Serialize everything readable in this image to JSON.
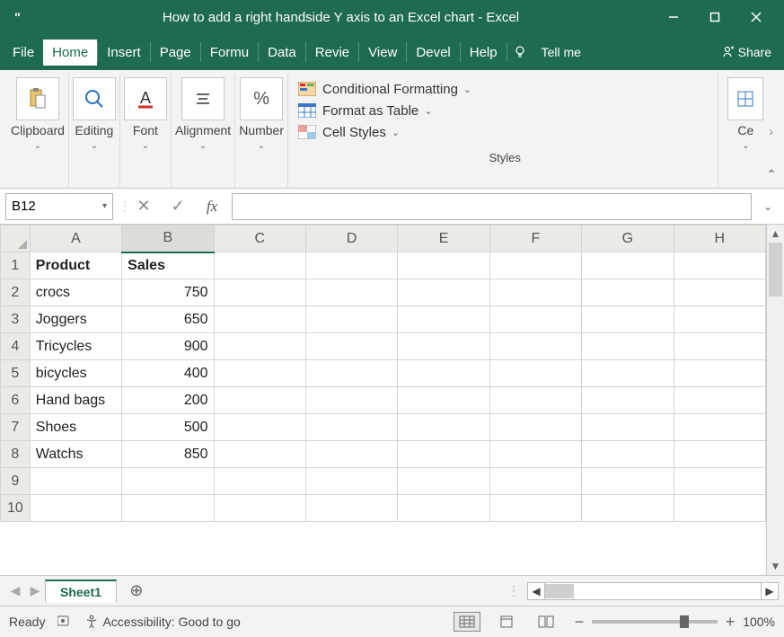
{
  "titlebar": {
    "title": "How to add a right handside Y axis to an Excel chart  -  Excel"
  },
  "tabs": {
    "file": "File",
    "home": "Home",
    "insert": "Insert",
    "page": "Page",
    "formulas": "Formu",
    "data": "Data",
    "review": "Revie",
    "view": "View",
    "developer": "Devel",
    "help": "Help",
    "tellme": "Tell me",
    "share": "Share"
  },
  "ribbon": {
    "clipboard": "Clipboard",
    "editing": "Editing",
    "font": "Font",
    "alignment": "Alignment",
    "number": "Number",
    "conditional": "Conditional Formatting",
    "formatastable": "Format as Table",
    "cellstyles": "Cell Styles",
    "styles": "Styles",
    "cells": "Ce"
  },
  "namebox": {
    "ref": "B12"
  },
  "formula": {
    "fx": "fx",
    "value": ""
  },
  "columns": [
    "A",
    "B",
    "C",
    "D",
    "E",
    "F",
    "G",
    "H"
  ],
  "rows": [
    "1",
    "2",
    "3",
    "4",
    "5",
    "6",
    "7",
    "8",
    "9",
    "10"
  ],
  "headers": {
    "product": "Product",
    "sales": "Sales"
  },
  "data": [
    {
      "product": "crocs",
      "sales": "750"
    },
    {
      "product": "Joggers",
      "sales": "650"
    },
    {
      "product": "Tricycles",
      "sales": "900"
    },
    {
      "product": "bicycles",
      "sales": "400"
    },
    {
      "product": "Hand bags",
      "sales": "200"
    },
    {
      "product": "Shoes",
      "sales": "500"
    },
    {
      "product": "Watchs",
      "sales": "850"
    }
  ],
  "sheets": {
    "active": "Sheet1"
  },
  "status": {
    "ready": "Ready",
    "accessibility": "Accessibility: Good to go",
    "zoom": "100%"
  }
}
